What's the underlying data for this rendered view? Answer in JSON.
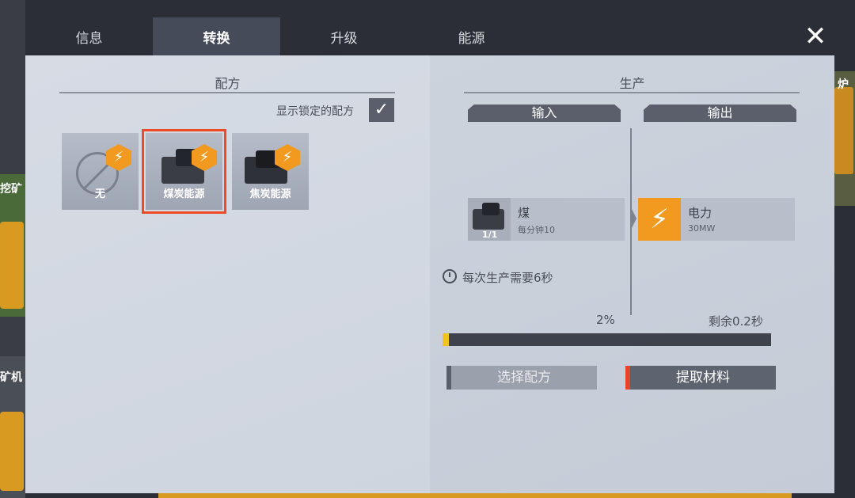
{
  "background": {
    "left_label_1": "挖矿",
    "left_label_2": "矿机",
    "right_label": "炉"
  },
  "tabs": [
    {
      "label": "信息",
      "active": false
    },
    {
      "label": "转换",
      "active": true
    },
    {
      "label": "升级",
      "active": false
    },
    {
      "label": "能源",
      "active": false
    }
  ],
  "close_label": "✕",
  "recipe_section": {
    "title": "配方",
    "show_locked_label": "显示锁定的配方",
    "show_locked_checked": true,
    "recipes": [
      {
        "name": "无",
        "icon": "none-icon",
        "selected": false
      },
      {
        "name": "煤炭能源",
        "icon": "coal-icon",
        "selected": true
      },
      {
        "name": "焦炭能源",
        "icon": "coke-icon",
        "selected": false
      }
    ],
    "badge_icon": "lightning-icon"
  },
  "production": {
    "title": "生产",
    "input_header": "输入",
    "output_header": "输出",
    "input_item": {
      "name": "煤",
      "rate": "每分钟10",
      "count": "1/1",
      "icon": "coal-icon"
    },
    "output_item": {
      "name": "电力",
      "rate": "30MW",
      "icon": "lightning-icon"
    },
    "time_text": "每次生产需要6秒",
    "progress_label": "2%",
    "progress_value": 0.02,
    "remaining_label": "剩余0.2秒",
    "select_recipe_button": "选择配方",
    "extract_button": "提取材料"
  },
  "colors": {
    "accent_orange": "#f29a1f",
    "selected_red": "#ee4a25",
    "progress_yellow": "#f2c21f"
  }
}
